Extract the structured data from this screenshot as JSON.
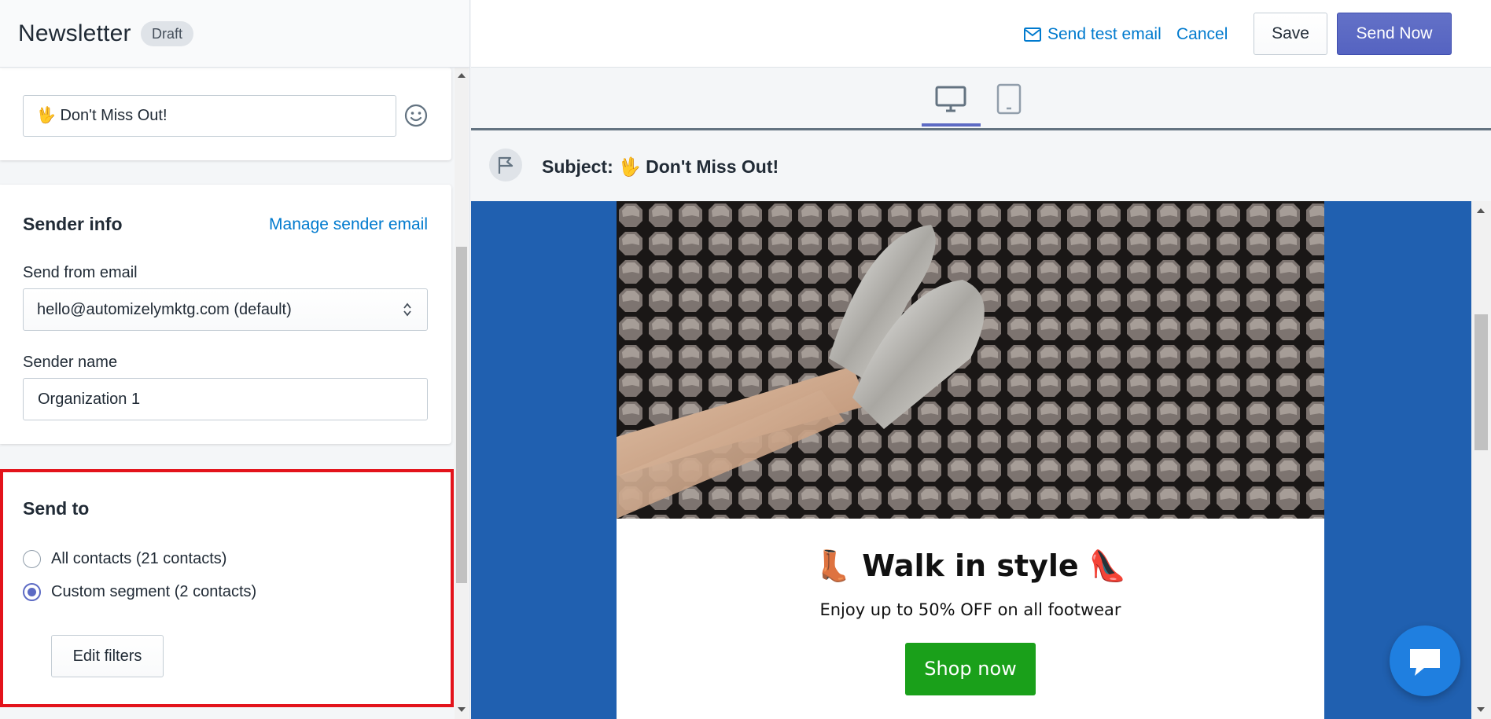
{
  "header": {
    "title": "Newsletter",
    "status_badge": "Draft"
  },
  "subject_card": {
    "subject_value": "🖖 Don't Miss Out!"
  },
  "sender_card": {
    "title": "Sender info",
    "manage_link": "Manage sender email",
    "send_from_label": "Send from email",
    "send_from_value": "hello@automizelymktg.com (default)",
    "sender_name_label": "Sender name",
    "sender_name_value": "Organization 1"
  },
  "send_to_card": {
    "title": "Send to",
    "options": [
      {
        "label": "All contacts (21 contacts)",
        "selected": false
      },
      {
        "label": "Custom segment (2 contacts)",
        "selected": true
      }
    ],
    "edit_filters_label": "Edit filters"
  },
  "toolbar": {
    "send_test_label": "Send test email",
    "cancel_label": "Cancel",
    "save_label": "Save",
    "send_now_label": "Send Now"
  },
  "preview": {
    "subject_prefix": "Subject:",
    "subject": "🖖 Don't Miss Out!",
    "headline": "👢 Walk in style 👠",
    "subline": "Enjoy up to 50% OFF on all footwear",
    "cta_label": "Shop now",
    "devices": [
      "desktop-icon",
      "mobile-icon"
    ],
    "active_device": "desktop"
  },
  "colors": {
    "primary": "#5c6ac4",
    "link": "#007ace",
    "preview_bg": "#2060b0",
    "cta": "#1aa01a",
    "highlight": "#e3131b"
  }
}
